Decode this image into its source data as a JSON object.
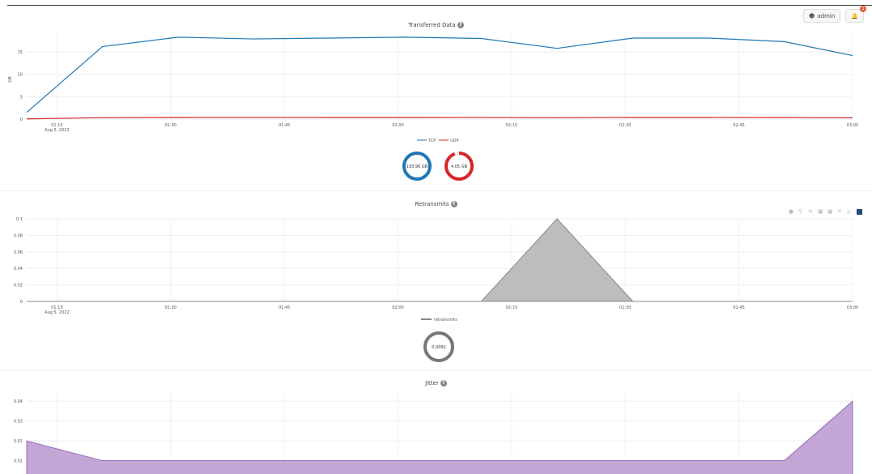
{
  "header": {
    "user_label": "admin",
    "notif_count": "1"
  },
  "transferred": {
    "title": "Transferred Data",
    "ylabel": "GB",
    "legend": [
      "TCP",
      "UDP"
    ],
    "donut_tcp": "193.96 GB",
    "donut_udp": "4.05 GB",
    "colors": {
      "tcp": "#1f77b4",
      "udp": "#d62728"
    }
  },
  "retransmits": {
    "title": "Retransmits",
    "legend": "retransmits",
    "donut_value": "0.0092"
  },
  "jitter": {
    "title": "Jitter"
  },
  "xticks": [
    "01:15",
    "01:30",
    "01:45",
    "02:00",
    "02:15",
    "02:30",
    "02:45",
    "03:00"
  ],
  "xdate": "Aug 5, 2022",
  "chart_data": [
    {
      "type": "line",
      "title": "Transferred Data",
      "ylabel": "GB",
      "ylim": [
        0,
        19
      ],
      "yticks": [
        0,
        5,
        10,
        15
      ],
      "x": [
        "01:11",
        "01:21",
        "01:31",
        "01:41",
        "01:51",
        "02:01",
        "02:11",
        "02:21",
        "02:31",
        "02:41",
        "02:51",
        "03:00"
      ],
      "series": [
        {
          "name": "TCP",
          "values": [
            1.5,
            16.2,
            18.3,
            17.9,
            18.1,
            18.3,
            18.0,
            15.8,
            18.1,
            18.1,
            17.3,
            14.2
          ]
        },
        {
          "name": "UDP",
          "values": [
            0.05,
            0.33,
            0.38,
            0.37,
            0.38,
            0.38,
            0.37,
            0.33,
            0.38,
            0.38,
            0.36,
            0.3
          ]
        }
      ]
    },
    {
      "type": "area",
      "title": "Retransmits",
      "ylim": [
        0,
        0.1
      ],
      "yticks": [
        0,
        0.02,
        0.04,
        0.06,
        0.08,
        0.1
      ],
      "x": [
        "01:11",
        "02:11",
        "02:21",
        "02:31",
        "03:00"
      ],
      "series": [
        {
          "name": "retransmits",
          "values": [
            0,
            0,
            0.1,
            0,
            0
          ]
        }
      ]
    },
    {
      "type": "area",
      "title": "Jitter",
      "ylim": [
        0,
        0.045
      ],
      "yticks": [
        0.01,
        0.02,
        0.03,
        0.04
      ],
      "x": [
        "01:11",
        "01:21",
        "02:51",
        "03:00"
      ],
      "series": [
        {
          "name": "jitter",
          "values": [
            0.02,
            0.01,
            0.01,
            0.04
          ]
        }
      ]
    }
  ]
}
